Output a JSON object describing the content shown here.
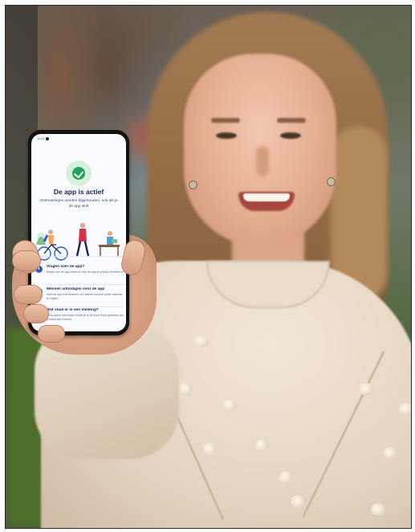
{
  "scene": {
    "subject": "woman-holding-phone"
  },
  "phone_app": {
    "status_time": "10:01",
    "status_icon": "status-dot-icon",
    "status_icon_name": "check-icon",
    "title": "De app is actief",
    "subtitle": "Ontmoetingen worden bijgehouden, ook als je de app sluit",
    "illustration": "people-outdoors-illustration",
    "list": [
      {
        "icon": "info-icon",
        "glyph": "i",
        "color": "#2a5bd7",
        "title": "Vragen over de app?",
        "description": "Bekijk hoe de app werkt en wat de app je privacy beschermt"
      },
      {
        "icon": "share-icon",
        "glyph": "+",
        "color": "#21a45a",
        "title": "Mensen uitnodigen voor de app",
        "description": "Deel de app met anderen om samen corona onder controle te krijgen"
      },
      {
        "icon": "alert-icon",
        "glyph": "○",
        "color": "#d6334a",
        "title": "Wat staat er in een melding?",
        "description": "Lees wat je kunt doen nadat je in de buurt bent geweest van iemand met corona"
      }
    ]
  }
}
